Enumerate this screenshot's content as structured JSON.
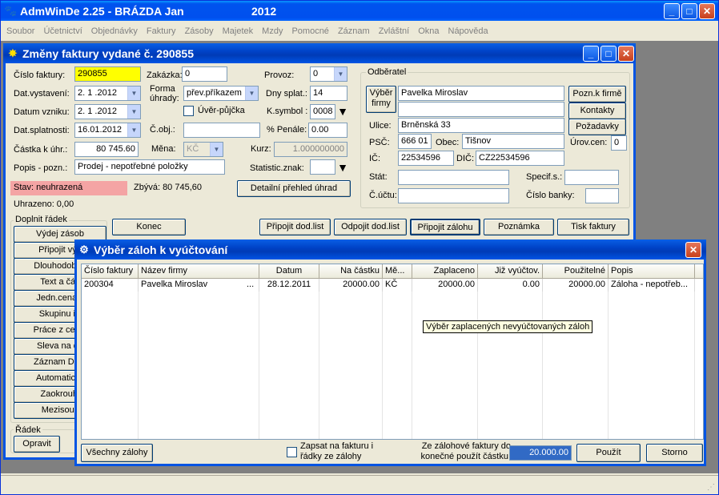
{
  "app": {
    "title": "AdmWinDe 2.25 - BRÁZDA Jan",
    "year": "2012",
    "menu": [
      "Soubor",
      "Účetnictví",
      "Objednávky",
      "Faktury",
      "Zásoby",
      "Majetek",
      "Mzdy",
      "Pomocné",
      "Záznam",
      "Zvláštní",
      "Okna",
      "Nápověda"
    ]
  },
  "invoice": {
    "title": "Změny faktury vydané č. 290855",
    "fields": {
      "cislo_label": "Číslo faktury:",
      "cislo": "290855",
      "zakazka_label": "Zakázka:",
      "zakazka": "0",
      "provoz_label": "Provoz:",
      "provoz": "0",
      "vystaveni_label": "Dat.vystavení:",
      "vystaveni": "2. 1 .2012",
      "forma_label": "Forma úhrady:",
      "forma": "přev.příkazem",
      "splat_label": "Dny splat.:",
      "splat": "14",
      "vzniku_label": "Datum vzniku:",
      "vzniku": "2. 1 .2012",
      "uver_label": "Úvěr-půjčka",
      "ksymbol_label": "K.symbol :",
      "ksymbol": "0008",
      "datsplat_label": "Dat.splatnosti:",
      "datsplat": "16.01.2012",
      "cobj_label": "Č.obj.:",
      "cobj": "",
      "penale_label": "% Penále:",
      "penale": "0.00",
      "castka_label": "Částka k úhr.:",
      "castka": "80 745.60",
      "mena_label": "Měna:",
      "mena": "KČ",
      "kurz_label": "Kurz:",
      "kurz": "1.000000000",
      "popis_label": "Popis - pozn.:",
      "popis": "Prodej - nepotřebné položky",
      "stat_label": "Statistic.znak:",
      "stat": ""
    },
    "stav": "Stav: neuhrazená",
    "zbyva": "Zbývá: 80 745,60",
    "prehled_button": "Detailní přehled úhrad",
    "uhrazeno": "Uhrazeno: 0,00",
    "odberatel": {
      "group_label": "Odběratel",
      "vyber_button": "Výběr firmy",
      "name": "Pavelka Miroslav",
      "name2": "",
      "ulice_label": "Ulice:",
      "ulice": "Brněnská 33",
      "psc_label": "PSČ:",
      "psc": "666 01",
      "obec_label": "Obec:",
      "obec": "Tišnov",
      "ic_label": "IČ:",
      "ic": "22534596",
      "dic_label": "DIČ:",
      "dic": "CZ22534596",
      "stat_label": "Stát:",
      "stat": "",
      "specif_label": "Specif.s.:",
      "specif": "",
      "ucet_label": "Č.účtu:",
      "ucet": "",
      "banka_label": "Číslo banky:",
      "banka": "",
      "uroven_label": "Úrov.cen:",
      "uroven": "0",
      "pozn_button": "Pozn.k firmě",
      "kontakty_button": "Kontakty",
      "pozadavky_button": "Požadavky"
    },
    "doplnit_label": "Doplnit řádek",
    "left_buttons": [
      "Výdej zásob",
      "Připojit výd",
      "Dlouhodob.m",
      "Text a čás",
      "Jedn.cena x",
      "Skupinu řá",
      "Práce z ceník",
      "Sleva na do",
      "Záznam DPH",
      "Automatický",
      "Zaokrouhl",
      "Mezisouč"
    ],
    "radek_label": "Řádek",
    "opravit_button": "Opravit",
    "konec_button": "Konec",
    "action_buttons": [
      "Připojit dod.list",
      "Odpojit dod.list",
      "Připojit zálohu",
      "Poznámka",
      "Tisk faktury"
    ]
  },
  "dialog": {
    "title": "Výběr záloh k vyúčtování",
    "columns": [
      "Číslo faktury",
      "Název firmy",
      "Datum",
      "Na částku",
      "Mě...",
      "Zaplaceno",
      "Již vyúčtov.",
      "Použitelné",
      "Popis"
    ],
    "rows": [
      [
        "200304",
        "Pavelka Miroslav",
        "28.12.2011",
        "20000.00",
        "KČ",
        "20000.00",
        "0.00",
        "20000.00",
        "Záloha - nepotřeb..."
      ]
    ],
    "row_ellipsis": "...",
    "tooltip": "Výběr zaplacených nevyúčtovaných záloh",
    "vsechny_button": "Všechny zálohy",
    "zapsat_label": "Zapsat na fakturu i řádky ze zálohy",
    "castka_label": "Ze zálohové faktury do konečné použít částku:",
    "castka": "20.000.00",
    "pouzit_button": "Použít",
    "storno_button": "Storno"
  },
  "colors": {
    "xp_blue": "#0054e3",
    "highlight_yellow": "#ffff00",
    "status_red": "#f4a4a4",
    "selected_blue": "#316ac5"
  }
}
